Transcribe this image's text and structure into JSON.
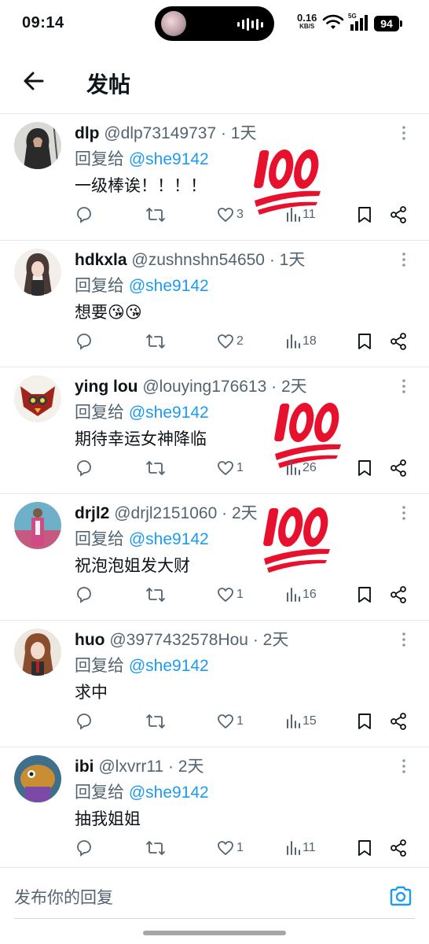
{
  "status_bar": {
    "time": "09:14",
    "net_speed": "0.16",
    "net_unit": "KB/S",
    "network": "5G",
    "battery": "94"
  },
  "header": {
    "title": "发帖"
  },
  "replies": [
    {
      "name": "dlp",
      "handle": "@dlp73149737",
      "time": "· 1天",
      "reply_label": "回复给",
      "reply_to": "@she9142",
      "text": "一级棒诶！！！！",
      "likes": "3",
      "views": "11"
    },
    {
      "name": "hdkxla",
      "handle": "@zushnshn54650",
      "time": "· 1天",
      "reply_label": "回复给",
      "reply_to": "@she9142",
      "text": "想要😘😘",
      "likes": "2",
      "views": "18"
    },
    {
      "name": "ying lou",
      "handle": "@louying176613",
      "time": "· 2天",
      "reply_label": "回复给",
      "reply_to": "@she9142",
      "text": "期待幸运女神降临",
      "likes": "1",
      "views": "26"
    },
    {
      "name": "drjl2",
      "handle": "@drjl2151060",
      "time": "· 2天",
      "reply_label": "回复给",
      "reply_to": "@she9142",
      "text": "祝泡泡姐发大财",
      "likes": "1",
      "views": "16"
    },
    {
      "name": "huo",
      "handle": "@3977432578Hou",
      "time": "· 2天",
      "reply_label": "回复给",
      "reply_to": "@she9142",
      "text": "求中",
      "likes": "1",
      "views": "15"
    },
    {
      "name": "ibi",
      "handle": "@lxvrr11",
      "time": "· 2天",
      "reply_label": "回复给",
      "reply_to": "@she9142",
      "text": "抽我姐姐",
      "likes": "1",
      "views": "11"
    }
  ],
  "composer": {
    "placeholder": "发布你的回复"
  },
  "colors": {
    "accent": "#1d9bf0",
    "secondary_text": "#536471",
    "emoji_100": "#e8112d"
  },
  "icons": [
    "back-arrow-icon",
    "reply-icon",
    "retweet-icon",
    "heart-icon",
    "views-icon",
    "bookmark-icon",
    "share-icon",
    "more-icon",
    "camera-icon",
    "hundred-points-emoji"
  ]
}
